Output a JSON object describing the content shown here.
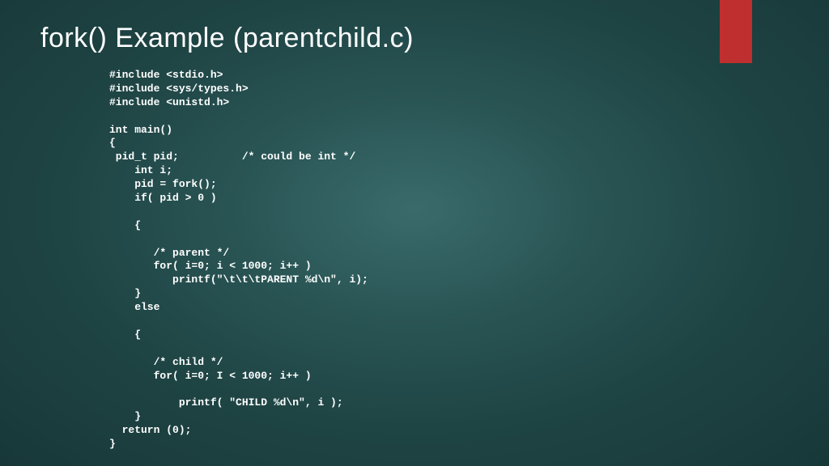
{
  "title": "fork() Example   (parentchild.c)",
  "code": "#include <stdio.h>\n#include <sys/types.h>\n#include <unistd.h>\n\nint main()\n{\n pid_t pid;          /* could be int */\n    int i;\n    pid = fork();\n    if( pid > 0 )\n\n    {\n\n       /* parent */\n       for( i=0; i < 1000; i++ )\n          printf(\"\\t\\t\\tPARENT %d\\n\", i);\n    }\n    else\n\n    {\n\n       /* child */\n       for( i=0; I < 1000; i++ )\n\n           printf( \"CHILD %d\\n\", i );\n    }\n  return (0);\n}"
}
